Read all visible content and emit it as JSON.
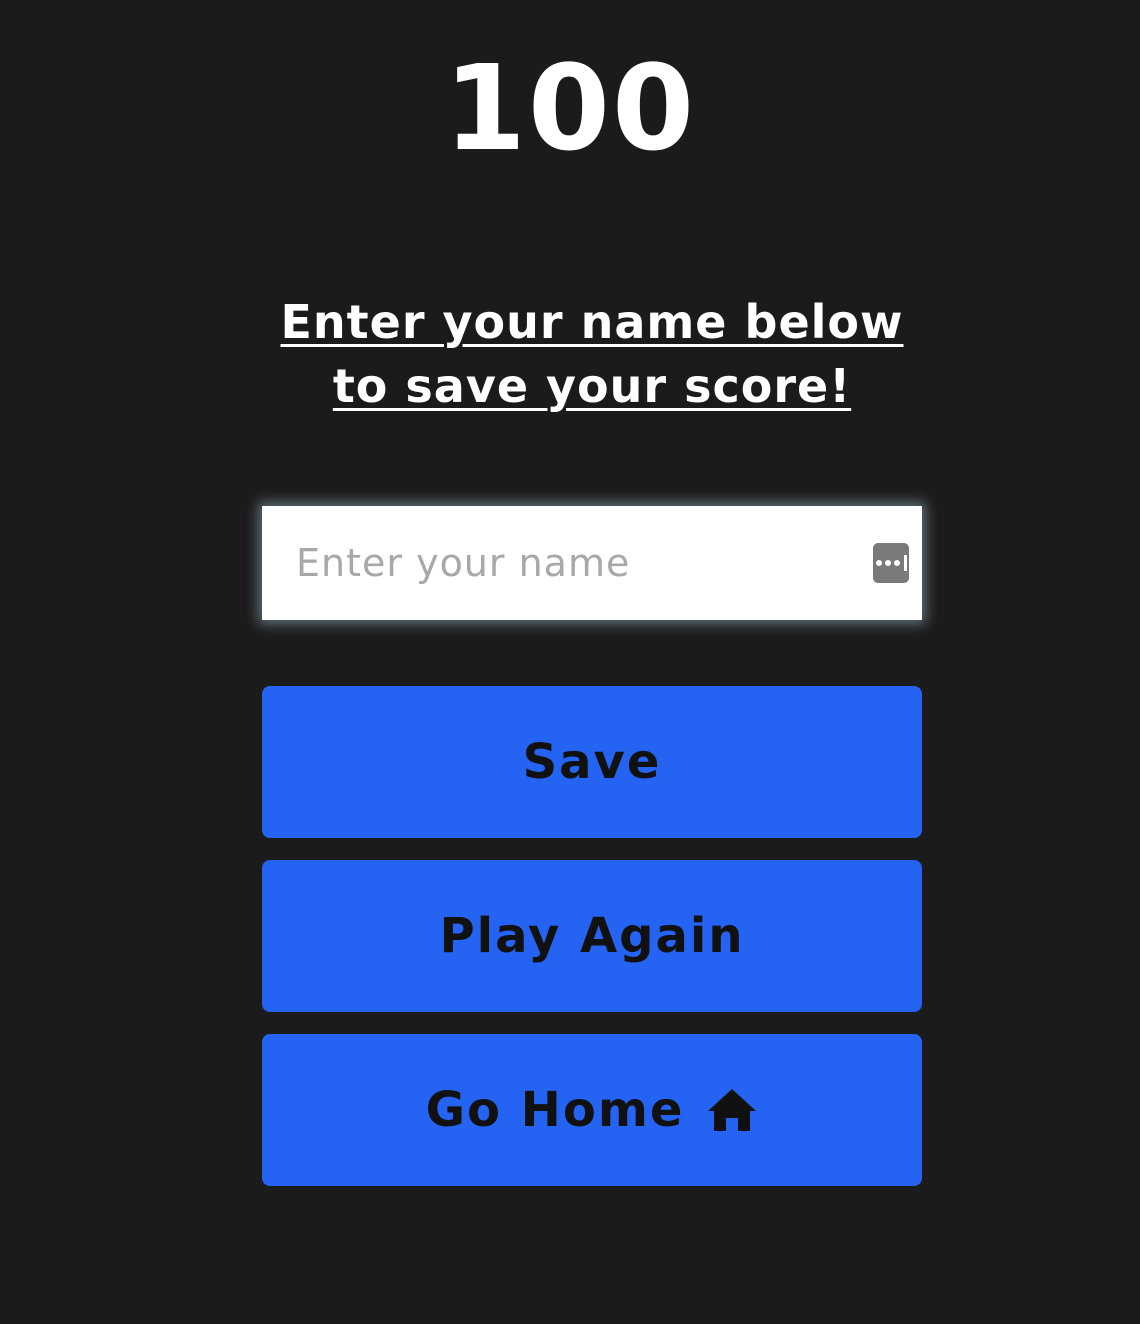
{
  "score": "100",
  "prompt": "Enter your name below to save your score!",
  "name_input": {
    "placeholder": "Enter your name",
    "value": ""
  },
  "buttons": {
    "save_label": "Save",
    "play_again_label": "Play Again",
    "go_home_label": "Go Home",
    "go_home_icon": "home-icon"
  },
  "colors": {
    "background": "#1c1b1c",
    "accent": "#2563f3",
    "text_light": "#ffffff",
    "text_dark": "#111111"
  }
}
